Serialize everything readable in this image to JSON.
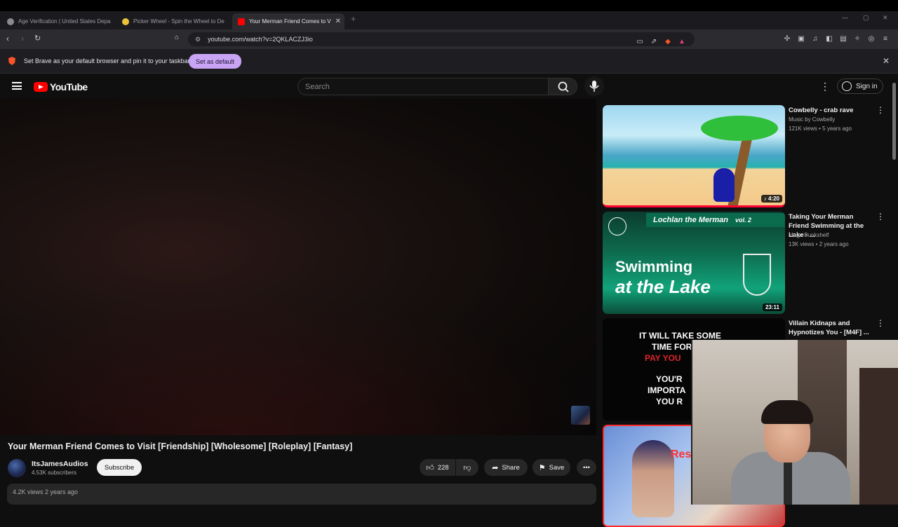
{
  "browser": {
    "tabs": [
      {
        "label": "Age Verification | United States Depa",
        "favicon_color": "#8a8a8a"
      },
      {
        "label": "Picker Wheel - Spin the Wheel to De",
        "favicon_color": "#e8c33a"
      },
      {
        "label": "Your Merman Friend Comes to V",
        "favicon_color": "#ff0000"
      }
    ],
    "new_tab": "+",
    "url": "youtube.com/watch?v=2QKLACZJ3io",
    "infobar_message": "Set Brave as your default browser and pin it to your taskbar",
    "set_default_label": "Set as default",
    "close": "✕"
  },
  "youtube": {
    "logo_text": "YouTube",
    "search_placeholder": "Search",
    "sign_in": "Sign in",
    "video": {
      "title": "Your Merman Friend Comes to Visit [Friendship] [Wholesome] [Roleplay] [Fantasy]",
      "channel": "ItsJamesAudios",
      "subscribers": "4.53K subscribers",
      "subscribe_label": "Subscribe",
      "likes": "228",
      "share_label": "Share",
      "save_label": "Save",
      "views": "4.2K views  2 years ago"
    },
    "recommendations": [
      {
        "title": "Cowbelly - crab rave",
        "channel": "Music by Cowbelly",
        "meta": "121K views • 5 years ago",
        "duration": "♪ 4:20"
      },
      {
        "title": "Taking Your Merman Friend Swimming at the Lake - ...",
        "channel": "Mage Bunkshelf",
        "meta": "13K views • 2 years ago",
        "duration": "23:11",
        "thumb_banner": "Lochlan the Merman",
        "thumb_vol": "vol. 2",
        "thumb_line1": "Swimming",
        "thumb_line2": "at the Lake"
      },
      {
        "title": "Villain Kidnaps and Hypnotizes You - [M4F] ...",
        "channel": "",
        "meta": "",
        "duration": "",
        "thumb_text1": "IT WILL TAKE SOME",
        "thumb_text2": "TIME FOR",
        "thumb_text3": "PAY YOU",
        "thumb_text4": "YOU'R",
        "thumb_text5": "IMPORTA",
        "thumb_text6": "YOU R"
      },
      {
        "title": "",
        "channel": "",
        "meta": "",
        "duration": "",
        "thumb_text": "Res"
      }
    ]
  },
  "colors": {
    "accent_purple": "#c9a4f5",
    "yt_red": "#ff0000",
    "brave_orange": "#fb542b"
  }
}
